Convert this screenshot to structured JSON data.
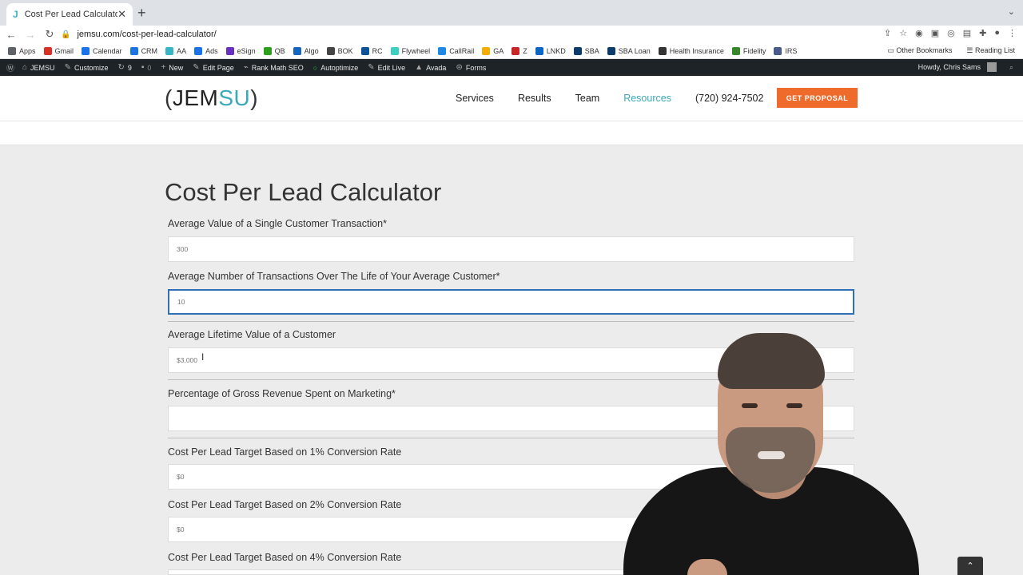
{
  "browser": {
    "tab_title": "Cost Per Lead Calculator",
    "tab_favicon": "J",
    "url": "jemsu.com/cost-per-lead-calculator/",
    "bookmarks": [
      {
        "label": "Apps",
        "color": "#5f6368"
      },
      {
        "label": "Gmail",
        "color": "#d93025"
      },
      {
        "label": "Calendar",
        "color": "#1a73e8"
      },
      {
        "label": "CRM",
        "color": "#1b74e4"
      },
      {
        "label": "AA",
        "color": "#39b3c6"
      },
      {
        "label": "Ads",
        "color": "#1a73e8"
      },
      {
        "label": "eSign",
        "color": "#6b2fbf"
      },
      {
        "label": "QB",
        "color": "#2ca01c"
      },
      {
        "label": "Algo",
        "color": "#1565c0"
      },
      {
        "label": "BOK",
        "color": "#444444"
      },
      {
        "label": "RC",
        "color": "#0b5394"
      },
      {
        "label": "Flywheel",
        "color": "#3ad0c0"
      },
      {
        "label": "CallRail",
        "color": "#1e88e5"
      },
      {
        "label": "GA",
        "color": "#f9ab00"
      },
      {
        "label": "Z",
        "color": "#c62828"
      },
      {
        "label": "LNKD",
        "color": "#0a66c2"
      },
      {
        "label": "SBA",
        "color": "#0b3d6b"
      },
      {
        "label": "SBA Loan",
        "color": "#0b3d6b"
      },
      {
        "label": "Health Insurance",
        "color": "#333333"
      },
      {
        "label": "Fidelity",
        "color": "#368727"
      },
      {
        "label": "IRS",
        "color": "#4a5a8a"
      }
    ],
    "other_bookmarks": "Other Bookmarks",
    "reading_list": "Reading List"
  },
  "adminbar": {
    "site": "JEMSU",
    "customize": "Customize",
    "updates": "9",
    "comments": "0",
    "new": "New",
    "edit_page": "Edit Page",
    "rank_math": "Rank Math SEO",
    "autoptimize": "Autoptimize",
    "edit_live": "Edit Live",
    "avada": "Avada",
    "forms": "Forms",
    "howdy": "Howdy, Chris Sams"
  },
  "site": {
    "logo_open": "(",
    "logo_jem": "JEM",
    "logo_su": "SU",
    "logo_close": ")",
    "nav": [
      "Services",
      "Results",
      "Team",
      "Resources",
      "(720) 924-7502"
    ],
    "cta": "GET PROPOSAL"
  },
  "calculator": {
    "title": "Cost Per Lead Calculator",
    "fields": [
      {
        "label": "Average Value of a Single Customer Transaction*",
        "value": "300"
      },
      {
        "label": "Average Number of Transactions Over The Life of Your Average Customer*",
        "value": "10"
      },
      {
        "label": "Average Lifetime Value of a Customer",
        "value": "$3,000"
      },
      {
        "label": "Percentage of Gross Revenue Spent on Marketing*",
        "value": ""
      },
      {
        "label": "Cost Per Lead Target Based on 1% Conversion Rate",
        "value": "$0"
      },
      {
        "label": "Cost Per Lead Target Based on 2% Conversion Rate",
        "value": "$0"
      },
      {
        "label": "Cost Per Lead Target Based on 4% Conversion Rate",
        "value": ""
      }
    ]
  },
  "colors": {
    "accent": "#3aaab8",
    "cta": "#ef6b2b",
    "adminbar": "#1d2327",
    "focus": "#2f6fb3"
  }
}
